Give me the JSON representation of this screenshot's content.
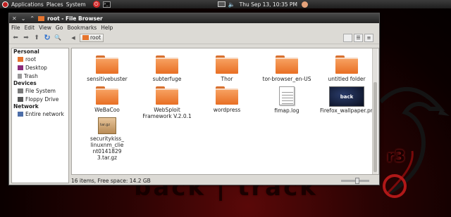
{
  "panel": {
    "menus": [
      "Applications",
      "Places",
      "System"
    ],
    "clock": "Thu Sep 13, 10:35 PM"
  },
  "desktop": {
    "logo_fragment": "r3",
    "watermark": "back | track"
  },
  "window": {
    "title": "root - File Browser",
    "menu": [
      "File",
      "Edit",
      "View",
      "Go",
      "Bookmarks",
      "Help"
    ],
    "location": "root"
  },
  "sidebar": {
    "sections": [
      {
        "title": "Personal",
        "items": [
          "root",
          "Desktop",
          "Trash"
        ]
      },
      {
        "title": "Devices",
        "items": [
          "File System",
          "Floppy Drive"
        ]
      },
      {
        "title": "Network",
        "items": [
          "Entire network"
        ]
      }
    ]
  },
  "files": [
    {
      "name": "sensitivebuster",
      "kind": "folder"
    },
    {
      "name": "subterfuge",
      "kind": "folder"
    },
    {
      "name": "Thor",
      "kind": "folder"
    },
    {
      "name": "tor-browser_en-US",
      "kind": "folder"
    },
    {
      "name": "untitled folder",
      "kind": "folder"
    },
    {
      "name": "WeBaCoo",
      "kind": "folder"
    },
    {
      "name": "WebSploit Framework V.2.0.1",
      "kind": "folder"
    },
    {
      "name": "wordpress",
      "kind": "folder"
    },
    {
      "name": "fimap.log",
      "kind": "text"
    },
    {
      "name": "Firefox_wallpaper.png",
      "kind": "image",
      "thumb_text": "back"
    },
    {
      "name": "securitykiss_linuxnm_client01418293.tar.gz",
      "kind": "archive",
      "badge": "tar.gz"
    }
  ],
  "status": {
    "text": "16 items, Free space: 14.2 GB"
  },
  "colors": {
    "folder": "#ec7a32",
    "titlebar": "#333333",
    "accent": "#c62a2a"
  }
}
